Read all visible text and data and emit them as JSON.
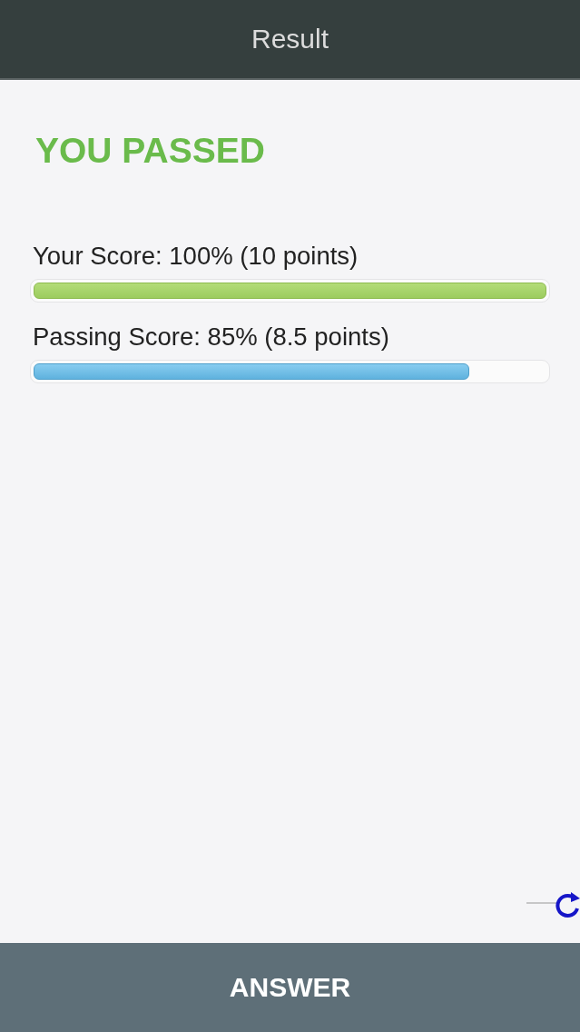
{
  "header": {
    "title": "Result"
  },
  "result": {
    "heading": "YOU PASSED",
    "passed": true
  },
  "scores": [
    {
      "kind": "score",
      "label": "Your Score: 100% (10 points)",
      "level": 1.0
    },
    {
      "kind": "passing",
      "label": "Passing Score: 85% (8.5 points)",
      "level": 0.85
    }
  ],
  "footer": {
    "button": "ANSWER"
  }
}
